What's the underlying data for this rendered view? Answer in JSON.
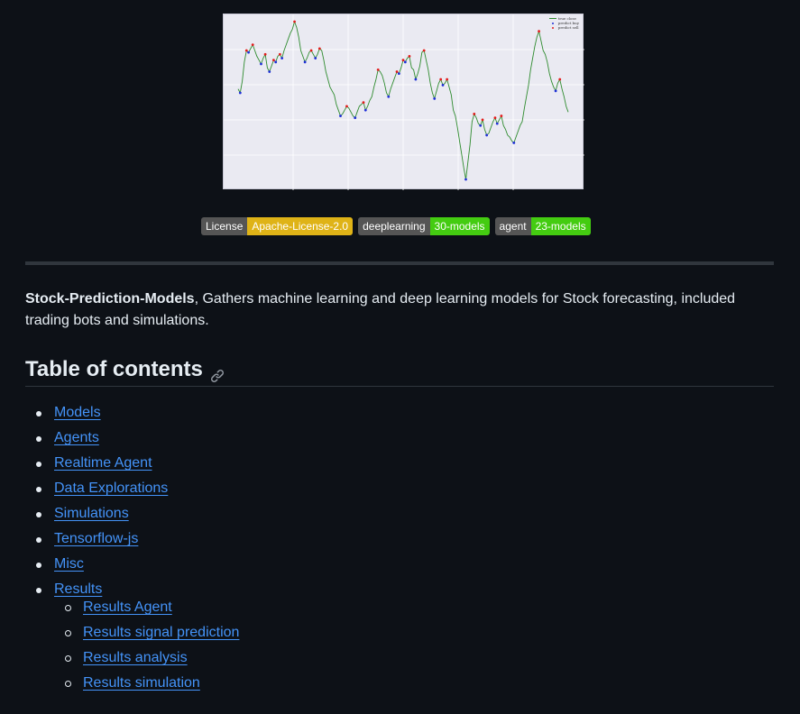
{
  "chart": {
    "legend": [
      "true close",
      "predict buy",
      "predict sell"
    ],
    "colors": {
      "line": "#2e8b2e",
      "buy": "#1f2fd8",
      "sell": "#e21b1b"
    },
    "chart_data": {
      "type": "line",
      "title": "",
      "xlabel": "",
      "ylabel": "",
      "grid": true,
      "legend_position": "top-right",
      "series": [
        {
          "name": "true close",
          "values": [
            52,
            50,
            56,
            66,
            72,
            71,
            73,
            75,
            72,
            69,
            67,
            65,
            68,
            70,
            63,
            61,
            64,
            67,
            66,
            69,
            70,
            68,
            72,
            75,
            78,
            81,
            83,
            87,
            84,
            79,
            72,
            69,
            66,
            68,
            71,
            72,
            70,
            68,
            70,
            73,
            72,
            67,
            61,
            57,
            53,
            51,
            49,
            44,
            41,
            38,
            39,
            41,
            43,
            42,
            40,
            38,
            37,
            40,
            43,
            44,
            45,
            41,
            43,
            46,
            48,
            53,
            57,
            62,
            61,
            59,
            55,
            50,
            48,
            52,
            55,
            58,
            61,
            60,
            63,
            67,
            66,
            68,
            69,
            63,
            62,
            57,
            60,
            64,
            71,
            72,
            67,
            62,
            55,
            50,
            47,
            51,
            55,
            57,
            54,
            55,
            57,
            53,
            49,
            41,
            38,
            32,
            25,
            18,
            11,
            5,
            14,
            23,
            35,
            39,
            37,
            34,
            33,
            36,
            31,
            28,
            29,
            32,
            35,
            37,
            34,
            36,
            38,
            33,
            31,
            28,
            27,
            25,
            24,
            27,
            30,
            33,
            35,
            42,
            48,
            54,
            62,
            68,
            74,
            79,
            82,
            77,
            72,
            70,
            66,
            60,
            56,
            53,
            51,
            55,
            57,
            52,
            48,
            43,
            40
          ]
        }
      ],
      "buy_points": "blue markers at local minima",
      "sell_points": "red markers at local maxima"
    }
  },
  "badges": [
    {
      "left": "License",
      "right": "Apache-License-2.0",
      "color": "#dfb317"
    },
    {
      "left": "deeplearning",
      "right": "30-models",
      "color": "#4c1"
    },
    {
      "left": "agent",
      "right": "23-models",
      "color": "#4c1"
    }
  ],
  "intro": {
    "bold": "Stock-Prediction-Models",
    "text": ", Gathers machine learning and deep learning models for Stock forecasting, included trading bots and simulations."
  },
  "toc": {
    "heading": "Table of contents",
    "items": [
      "Models",
      "Agents",
      "Realtime Agent",
      "Data Explorations",
      "Simulations",
      "Tensorflow-js",
      "Misc",
      "Results"
    ],
    "sub_items": [
      "Results Agent",
      "Results signal prediction",
      "Results analysis",
      "Results simulation"
    ]
  }
}
